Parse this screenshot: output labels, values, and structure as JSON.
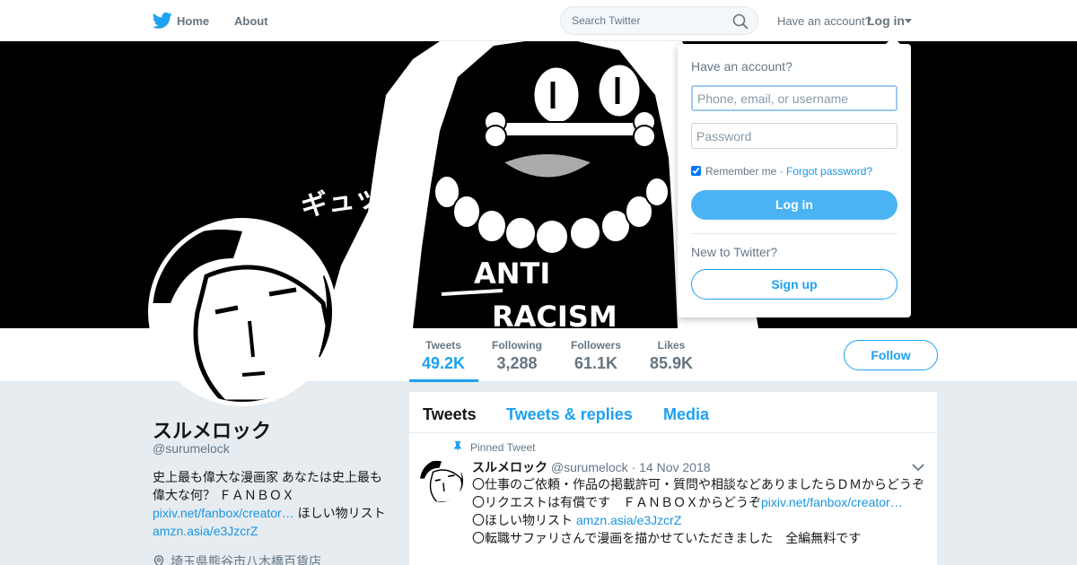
{
  "nav": {
    "home_label": "Home",
    "about_label": "About",
    "search_placeholder": "Search Twitter",
    "have_account": "Have an account?",
    "login_label": "Log in",
    "accent": "#1da1f2",
    "icons": [
      "twitter-bird-icon",
      "search-icon",
      "caret-down-icon"
    ]
  },
  "banner": {
    "art_text_top": "ギュッ",
    "art_text_shirt_1": "ANTI",
    "art_text_shirt_2": "RACISM"
  },
  "stats": [
    {
      "label": "Tweets",
      "value": "49.2K"
    },
    {
      "label": "Following",
      "value": "3,288"
    },
    {
      "label": "Followers",
      "value": "61.1K"
    },
    {
      "label": "Likes",
      "value": "85.9K"
    }
  ],
  "follow_label": "Follow",
  "profile": {
    "name": "スルメロック",
    "screen_name": "@surumelock",
    "bio_1": "史上最も偉大な漫画家 あなたは史上最も偉大な何？ ＦＡＮＢＯＸ",
    "bio_link_1": "pixiv.net/fanbox/creator…",
    "bio_2": " ほしい物リスト ",
    "bio_link_2": "amzn.asia/e3JzcrZ",
    "location": "埼玉県熊谷市八木橋百貨店"
  },
  "timeline": {
    "tabs": [
      "Tweets",
      "Tweets & replies",
      "Media"
    ],
    "pinned_label": "Pinned Tweet",
    "tweet": {
      "name": "スルメロック",
      "meta": "@surumelock · 14 Nov 2018",
      "line1": "〇仕事のご依頼・作品の掲載許可・質問や相談などありましたらＤＭからどうぞ",
      "line2": "〇リクエストは有償です　ＦＡＮＢＯＸからどうぞ",
      "line2_link": "pixiv.net/fanbox/creator…",
      "line3": "〇ほしい物リスト ",
      "line3_link": "amzn.asia/e3JzcrZ",
      "line4": "〇転職サファリさんで漫画を描かせていただきました　全編無料です"
    }
  },
  "login_dropdown": {
    "title": "Have an account?",
    "username_placeholder": "Phone, email, or username",
    "password_placeholder": "Password",
    "remember_label": "Remember me",
    "separator": " · ",
    "forgot_label": "Forgot password?",
    "login_button": "Log in",
    "new_label": "New to Twitter?",
    "signup_button": "Sign up",
    "remember_checked": true
  }
}
